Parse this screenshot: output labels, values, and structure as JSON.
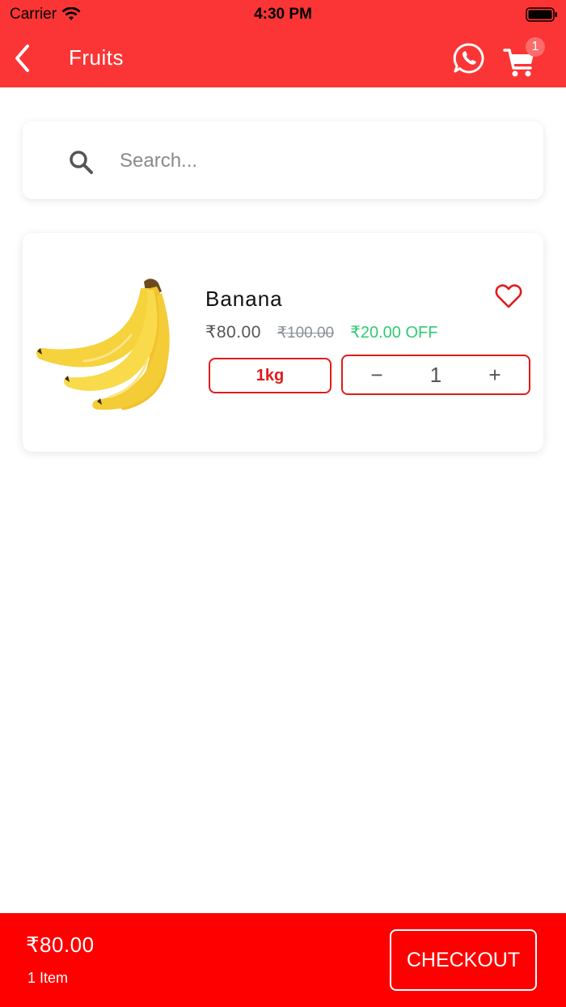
{
  "status_bar": {
    "carrier": "Carrier",
    "time": "4:30 PM"
  },
  "nav": {
    "title": "Fruits",
    "cart_count": "1"
  },
  "search": {
    "placeholder": "Search..."
  },
  "products": [
    {
      "name": "Banana",
      "price": "₹80.00",
      "original_price": "₹100.00",
      "discount": "₹20.00 OFF",
      "variant": "1kg",
      "quantity": "1",
      "minus_label": "−",
      "plus_label": "+"
    }
  ],
  "footer": {
    "total": "₹80.00",
    "items": "1 Item",
    "checkout_label": "CHECKOUT"
  },
  "colors": {
    "header": "#fb3535",
    "footer": "#ff0000",
    "accent": "#e01b1b",
    "discount": "#2ecc71"
  },
  "icons": {
    "back": "chevron-left-icon",
    "whatsapp": "whatsapp-icon",
    "cart": "cart-icon",
    "search": "search-icon",
    "favorite": "heart-icon"
  }
}
